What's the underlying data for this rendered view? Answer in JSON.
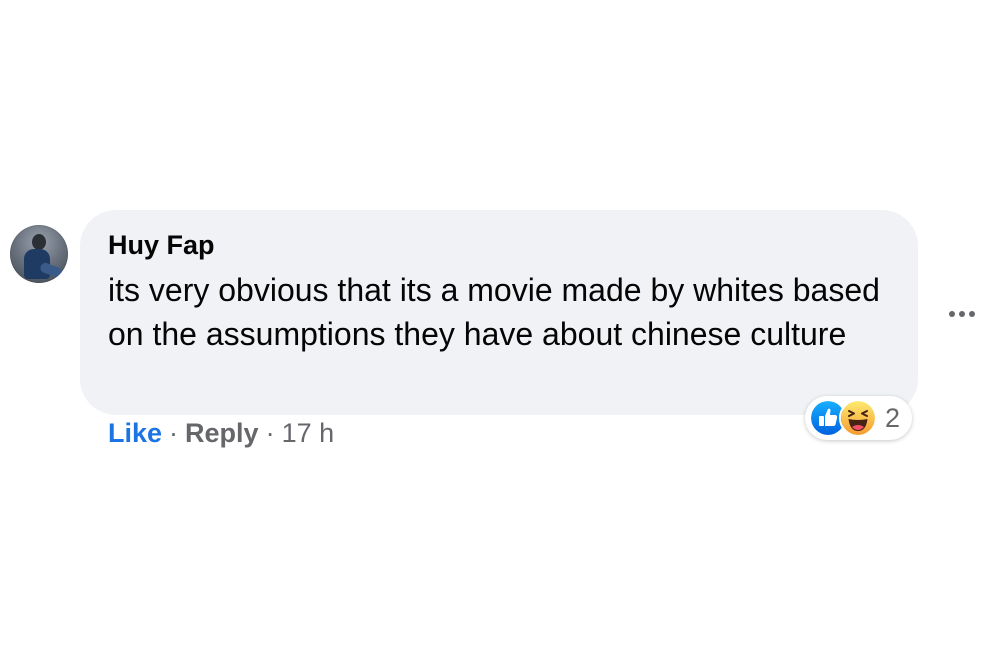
{
  "comment": {
    "author": "Huy Fap",
    "text": "its very obvious that its a movie made by whites based on the assumptions they have about chinese culture",
    "actions": {
      "like": "Like",
      "separator": "·",
      "reply": "Reply",
      "time": "17 h"
    },
    "reactions": {
      "icons": [
        "like-icon",
        "haha-icon"
      ],
      "count": "2"
    }
  },
  "colors": {
    "link": "#1b74e4",
    "bubble": "#f0f2f5",
    "text": "#050505",
    "muted": "#65676b"
  }
}
